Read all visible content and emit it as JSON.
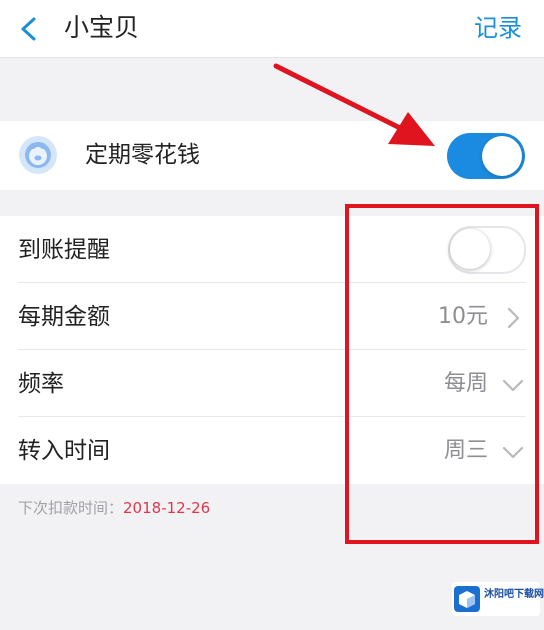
{
  "header": {
    "back_icon": "chevron-left-icon",
    "title": "小宝贝",
    "action_label": "记录"
  },
  "main_switch": {
    "icon": "piggy-bank-icon",
    "label": "定期零花钱",
    "enabled": true
  },
  "settings": {
    "items": [
      {
        "label": "到账提醒",
        "control": "toggle",
        "enabled": false
      },
      {
        "label": "每期金额",
        "value": "10元",
        "control": "chevron-right"
      },
      {
        "label": "频率",
        "value": "每周",
        "control": "chevron-down"
      },
      {
        "label": "转入时间",
        "value": "周三",
        "control": "chevron-down"
      }
    ]
  },
  "next_debit": {
    "label": "下次扣款时间：",
    "date": "2018-12-26"
  },
  "annotations": {
    "color": "#e0141e",
    "arrow": "arrow pointing to main switch",
    "box": "box around settings controls"
  },
  "watermark": {
    "text": "沐阳吧下载网"
  },
  "colors": {
    "accent": "#1a8be0",
    "header_action": "#1b8fd6",
    "date_highlight": "#e2364b",
    "annotation": "#e0141e"
  }
}
